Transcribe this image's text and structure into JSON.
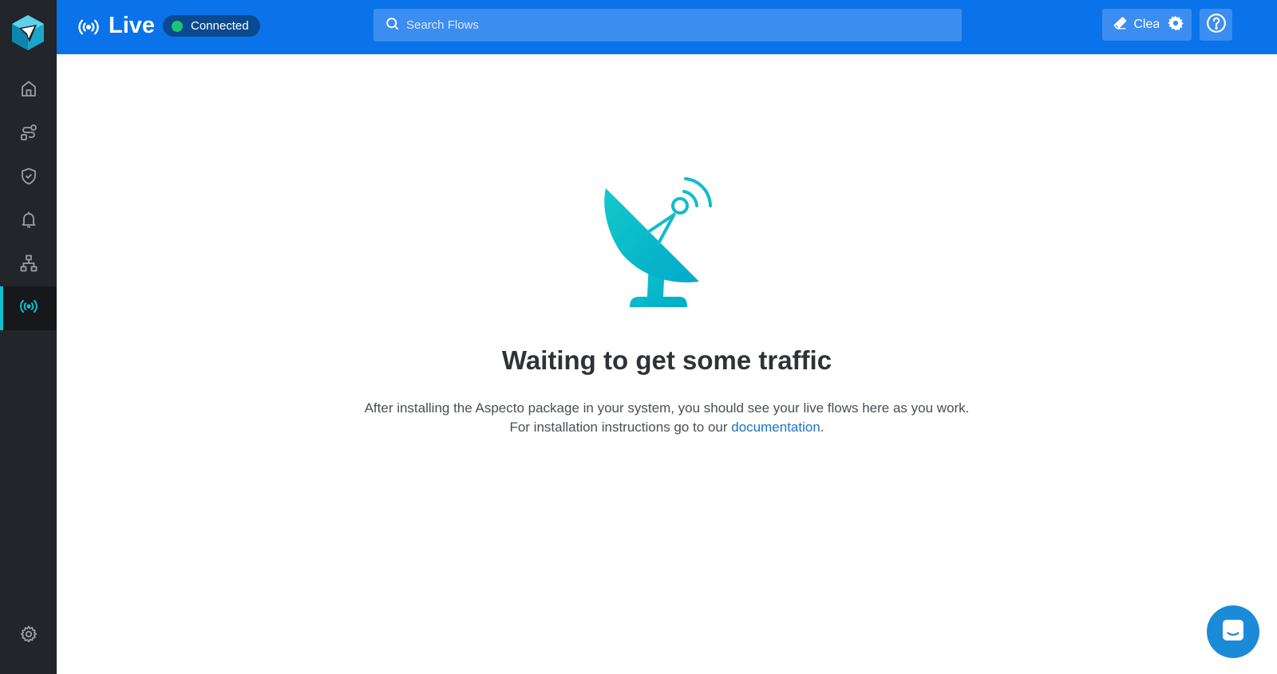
{
  "sidebar": {
    "logo": "aspecto-logo",
    "items": [
      {
        "icon": "home-icon",
        "active": false
      },
      {
        "icon": "flows-icon",
        "active": false
      },
      {
        "icon": "shield-check-icon",
        "active": false
      },
      {
        "icon": "bell-icon",
        "active": false
      },
      {
        "icon": "sitemap-icon",
        "active": false
      },
      {
        "icon": "live-broadcast-icon",
        "active": true
      }
    ],
    "bottom_item": {
      "icon": "settings-gear-icon"
    }
  },
  "header": {
    "title": "Live",
    "status_label": "Connected",
    "search_placeholder": "Search Flows",
    "clear_label": "Clear"
  },
  "empty_state": {
    "title": "Waiting to get some traffic",
    "line1": "After installing the Aspecto package in your system, you should see your live flows here as you work.",
    "line2_prefix": "For installation instructions go to our ",
    "link_text": "documentation",
    "line2_suffix": "."
  },
  "colors": {
    "sidebar_bg": "#22252a",
    "header_bg": "#0a73ea",
    "accent_teal": "#0fbfcf",
    "status_green": "#1bc574",
    "link": "#1a73c8"
  }
}
